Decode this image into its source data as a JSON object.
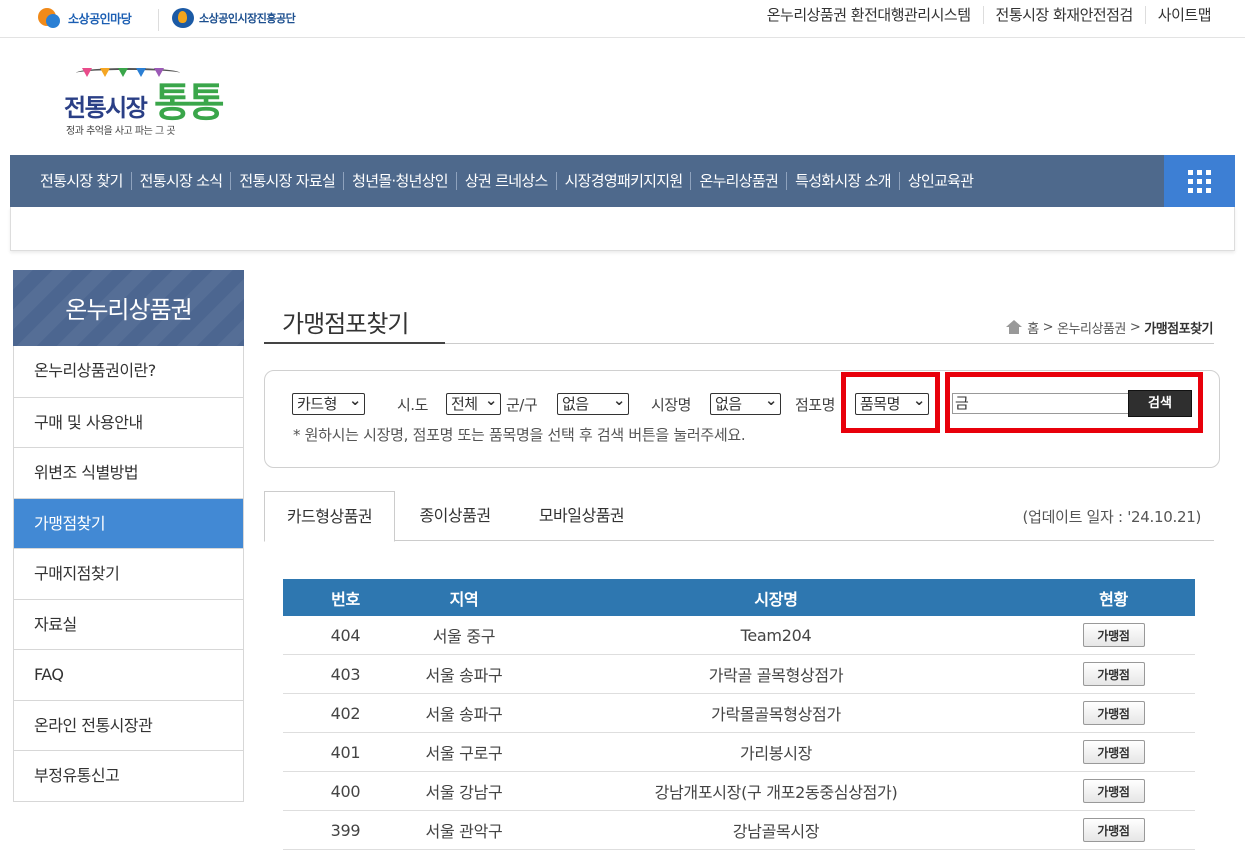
{
  "topbar": {
    "logo1": "소상공인마당",
    "logo2": "소상공인시장진흥공단",
    "links": [
      "온누리상품권 환전대행관리시스템",
      "전통시장 화재안전점검",
      "사이트맵"
    ]
  },
  "brand": {
    "title_a": "전통시장",
    "title_b": "통통",
    "tagline": "정과 추억을 사고 파는 그 곳"
  },
  "gnb": {
    "items": [
      "전통시장 찾기",
      "전통시장 소식",
      "전통시장 자료실",
      "청년몰·청년상인",
      "상권 르네상스",
      "시장경영패키지지원",
      "온누리상품권",
      "특성화시장 소개",
      "상인교육관"
    ]
  },
  "sidebar": {
    "title": "온누리상품권",
    "items": [
      "온누리상품권이란?",
      "구매 및 사용안내",
      "위변조 식별방법",
      "가맹점찾기",
      "구매지점찾기",
      "자료실",
      "FAQ",
      "온라인 전통시장관",
      "부정유통신고"
    ],
    "active_index": 3
  },
  "page": {
    "title": "가맹점포찾기",
    "breadcrumb": [
      "홈",
      "온누리상품권",
      "가맹점포찾기"
    ]
  },
  "search": {
    "type_value": "카드형",
    "sido_label": "시.도",
    "sido_value": "전체",
    "gungu_label": "군/구",
    "gungu_value": "없음",
    "market_label": "시장명",
    "market_value": "없음",
    "store_label": "점포명",
    "item_value": "품목명",
    "keyword_value": "금",
    "button_label": "검색",
    "hint": "* 원하시는 시장명, 점포명 또는 품목명을 선택 후 검색 버튼을 눌러주세요."
  },
  "tabs": [
    "카드형상품권",
    "종이상품권",
    "모바일상품권"
  ],
  "update_text": "(업데이트 일자 : '24.10.21)",
  "table": {
    "headers": [
      "번호",
      "지역",
      "시장명",
      "현황"
    ],
    "rows": [
      {
        "no": "404",
        "region": "서울 중구",
        "market": "Team204",
        "status": "가맹점"
      },
      {
        "no": "403",
        "region": "서울 송파구",
        "market": "가락골 골목형상점가",
        "status": "가맹점"
      },
      {
        "no": "402",
        "region": "서울 송파구",
        "market": "가락몰골목형상점가",
        "status": "가맹점"
      },
      {
        "no": "401",
        "region": "서울 구로구",
        "market": "가리봉시장",
        "status": "가맹점"
      },
      {
        "no": "400",
        "region": "서울 강남구",
        "market": "강남개포시장(구 개포2동중심상점가)",
        "status": "가맹점"
      },
      {
        "no": "399",
        "region": "서울 관악구",
        "market": "강남골목시장",
        "status": "가맹점"
      }
    ]
  },
  "colors": {
    "gnb": "#4e698c",
    "active": "#4289d4",
    "table_head": "#2e77b0",
    "highlight": "#e8000b"
  }
}
